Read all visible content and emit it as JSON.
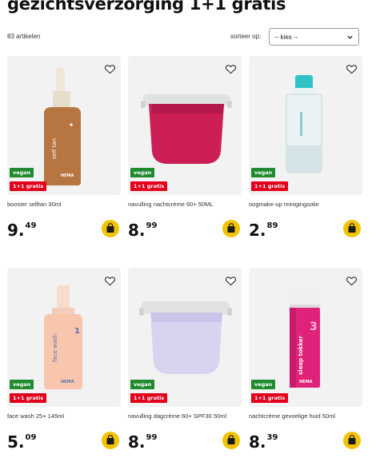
{
  "page": {
    "title": "gezichtsverzorging 1+1 gratis",
    "article_count": "83 artikelen",
    "sort_label": "sorteer op:",
    "sort_value": "-- kies --"
  },
  "colors": {
    "vegan_badge": "#1f8a2e",
    "promo_badge": "#e2001a",
    "cart_button": "#f3c300",
    "tile_background": "#f2f2f2"
  },
  "products": [
    {
      "name": "booster selftan 30ml",
      "price_euros": "9.",
      "price_cents": "49",
      "badges": [
        "vegan",
        "1+1 gratis"
      ],
      "label_text": "self tan",
      "brand_text": "HEMA"
    },
    {
      "name": "navulling nachtcrème 60+ 50ML",
      "price_euros": "8.",
      "price_cents": "99",
      "badges": [
        "vegan",
        "1+1 gratis"
      ]
    },
    {
      "name": "oogmake-up reinigingsolie",
      "price_euros": "2.",
      "price_cents": "89",
      "badges": [
        "vegan",
        "1+1 gratis"
      ]
    },
    {
      "name": "face wash 25+ 145ml",
      "price_euros": "5.",
      "price_cents": "09",
      "badges": [
        "vegan",
        "1+1 gratis"
      ],
      "label_text": "face wash",
      "brand_text": "HEMA",
      "number_text": "1"
    },
    {
      "name": "navulling dagcrème 60+ SPF30 50ml",
      "price_euros": "8.",
      "price_cents": "99",
      "badges": [
        "vegan",
        "1+1 gratis"
      ]
    },
    {
      "name": "nachtcrème gevoelige huid 50ml",
      "price_euros": "8.",
      "price_cents": "39",
      "badges": [
        "vegan",
        "1+1 gratis"
      ],
      "label_text": "sleep tokker",
      "brand_text": "HEMA",
      "number_text": "3"
    }
  ],
  "icons": {
    "favorite": "heart-icon",
    "cart": "shopping-bag-icon",
    "select": "chevron-down-icon"
  }
}
